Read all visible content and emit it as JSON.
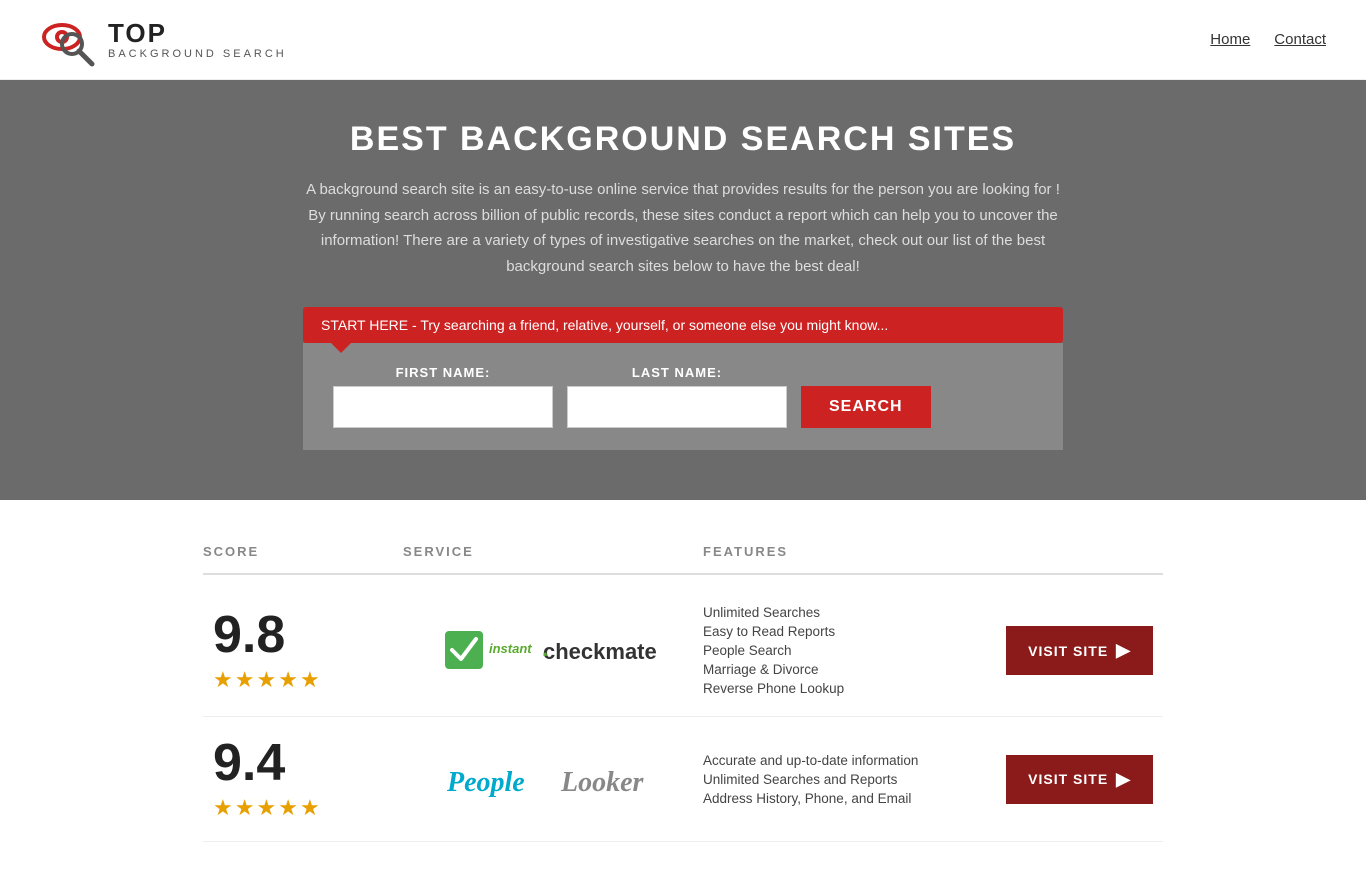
{
  "header": {
    "logo_top": "TOP",
    "logo_bottom": "BACKGROUND SEARCH",
    "nav": [
      {
        "label": "Home",
        "href": "#"
      },
      {
        "label": "Contact",
        "href": "#"
      }
    ]
  },
  "hero": {
    "title": "BEST BACKGROUND SEARCH SITES",
    "description": "A background search site is an easy-to-use online service that provides results  for the person you are looking for ! By  running  search across billion of public records, these sites conduct  a report which can help you to uncover the information! There are a variety of types of investigative searches on the market, check out our  list of the best background search sites below to have the best deal!",
    "callout": "START HERE - Try searching a friend, relative, yourself, or someone else you might know...",
    "fields": {
      "first_name_label": "FIRST NAME:",
      "last_name_label": "LAST NAME:",
      "first_name_placeholder": "",
      "last_name_placeholder": "",
      "search_button": "SEARCH"
    }
  },
  "table": {
    "headers": {
      "score": "SCORE",
      "service": "SERVICE",
      "features": "FEATURES"
    },
    "rows": [
      {
        "score": "9.8",
        "stars": 4.5,
        "service_name": "Instant Checkmate",
        "service_logo_type": "checkmate",
        "features": [
          "Unlimited Searches",
          "Easy to Read Reports",
          "People Search",
          "Marriage & Divorce",
          "Reverse Phone Lookup"
        ],
        "visit_label": "VISIT SITE"
      },
      {
        "score": "9.4",
        "stars": 4.5,
        "service_name": "PeopleLooker",
        "service_logo_type": "peoplelooker",
        "features": [
          "Accurate and up-to-date information",
          "Unlimited Searches and Reports",
          "Address History, Phone, and Email"
        ],
        "visit_label": "VISIT SITE"
      }
    ]
  }
}
